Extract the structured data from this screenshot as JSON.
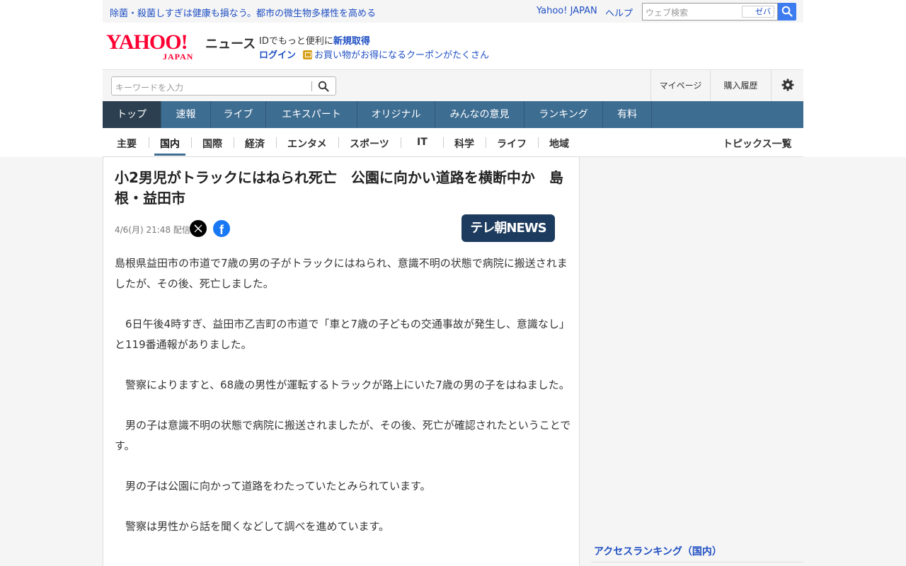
{
  "topbar": {
    "promo": "除菌・殺菌しすぎは健康も損なう。都市の微生物多様性を高める",
    "yahoo_japan": "Yahoo! JAPAN",
    "help": "ヘルプ",
    "web_search_placeholder": "ウェブ検索",
    "zeba": "ゼバ"
  },
  "brand": {
    "logo_main": "YAHOO!",
    "logo_sub": "JAPAN",
    "section": "ニュース",
    "id_prefix": "IDでもっと便利に",
    "id_link": "新規取得",
    "login": "ログイン",
    "coupon": "お買い物がお得になるクーポンがたくさん"
  },
  "search": {
    "placeholder": "キーワードを入力",
    "mypage": "マイページ",
    "history": "購入履歴"
  },
  "global_nav": [
    "トップ",
    "速報",
    "ライブ",
    "エキスパート",
    "オリジナル",
    "みんなの意見",
    "ランキング",
    "有料"
  ],
  "sub_nav": [
    "主要",
    "国内",
    "国際",
    "経済",
    "エンタメ",
    "スポーツ",
    "IT",
    "科学",
    "ライフ",
    "地域"
  ],
  "topics_list": "トピックス一覧",
  "article": {
    "title": "小2男児がトラックにはねられ死亡　公園に向かい道路を横断中か　島根・益田市",
    "date": "4/6(月) 21:48 配信",
    "source": "テレ朝NEWS",
    "paragraphs": [
      "島根県益田市の市道で7歳の男の子がトラックにはねられ、意識不明の状態で病院に搬送されましたが、その後、死亡しました。",
      "　6日午後4時すぎ、益田市乙吉町の市道で「車と7歳の子どもの交通事故が発生し、意識なし」と119番通報がありました。",
      "　警察によりますと、68歳の男性が運転するトラックが路上にいた7歳の男の子をはねました。",
      "　男の子は意識不明の状態で病院に搬送されましたが、その後、死亡が確認されたということです。",
      "　男の子は公園に向かって道路をわたっていたとみられています。",
      "　警察は男性から話を聞くなどして調べを進めています。"
    ]
  },
  "sidebar": {
    "ranking_title": "アクセスランキング（国内）"
  }
}
